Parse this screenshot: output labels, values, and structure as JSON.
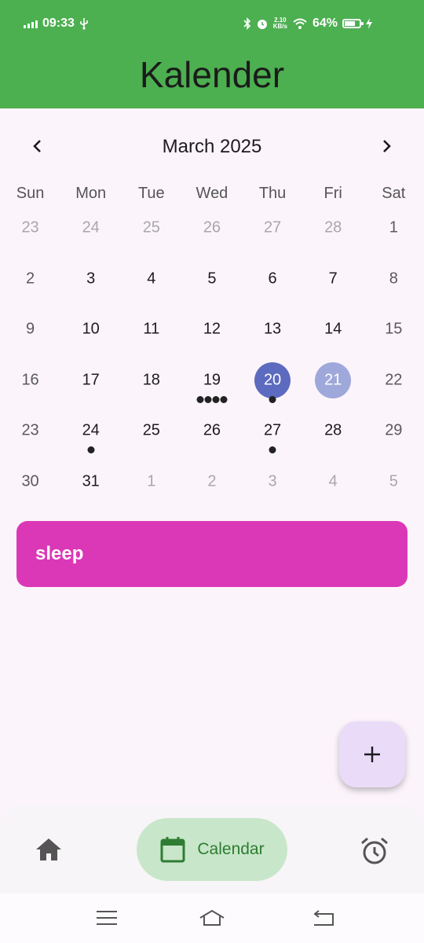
{
  "status_bar": {
    "time": "09:33",
    "net_speed_value": "2.10",
    "net_speed_unit": "KB/s",
    "battery": "64%",
    "battery_level": 0.64
  },
  "header": {
    "title": "Kalender"
  },
  "calendar": {
    "month_label": "March 2025",
    "weekdays": [
      "Sun",
      "Mon",
      "Tue",
      "Wed",
      "Thu",
      "Fri",
      "Sat"
    ],
    "weeks": [
      [
        {
          "n": "23",
          "other": true
        },
        {
          "n": "24",
          "other": true
        },
        {
          "n": "25",
          "other": true
        },
        {
          "n": "26",
          "other": true
        },
        {
          "n": "27",
          "other": true
        },
        {
          "n": "28",
          "other": true
        },
        {
          "n": "1"
        }
      ],
      [
        {
          "n": "2"
        },
        {
          "n": "3"
        },
        {
          "n": "4"
        },
        {
          "n": "5"
        },
        {
          "n": "6"
        },
        {
          "n": "7"
        },
        {
          "n": "8"
        }
      ],
      [
        {
          "n": "9"
        },
        {
          "n": "10"
        },
        {
          "n": "11"
        },
        {
          "n": "12"
        },
        {
          "n": "13"
        },
        {
          "n": "14"
        },
        {
          "n": "15"
        }
      ],
      [
        {
          "n": "16"
        },
        {
          "n": "17"
        },
        {
          "n": "18"
        },
        {
          "n": "19",
          "markers": 4
        },
        {
          "n": "20",
          "state": "selected",
          "markers": 1
        },
        {
          "n": "21",
          "state": "today"
        },
        {
          "n": "22"
        }
      ],
      [
        {
          "n": "23"
        },
        {
          "n": "24",
          "markers": 1
        },
        {
          "n": "25"
        },
        {
          "n": "26"
        },
        {
          "n": "27",
          "markers": 1
        },
        {
          "n": "28"
        },
        {
          "n": "29"
        }
      ],
      [
        {
          "n": "30"
        },
        {
          "n": "31"
        },
        {
          "n": "1",
          "other": true
        },
        {
          "n": "2",
          "other": true
        },
        {
          "n": "3",
          "other": true
        },
        {
          "n": "4",
          "other": true
        },
        {
          "n": "5",
          "other": true
        }
      ]
    ]
  },
  "events": [
    {
      "title": "sleep",
      "color": "#db38b7"
    }
  ],
  "fab": {
    "icon": "plus-icon"
  },
  "bottom_nav": {
    "items": [
      {
        "icon": "home-icon"
      },
      {
        "icon": "calendar-icon",
        "label": "Calendar",
        "active": true
      },
      {
        "icon": "alarm-clock-icon"
      }
    ]
  },
  "colors": {
    "header": "#4caf50",
    "selected_day": "#5c6bc0",
    "today": "#9fa8da",
    "event": "#db38b7",
    "fab": "#eadcf8",
    "nav_active": "#c8e6c9"
  }
}
